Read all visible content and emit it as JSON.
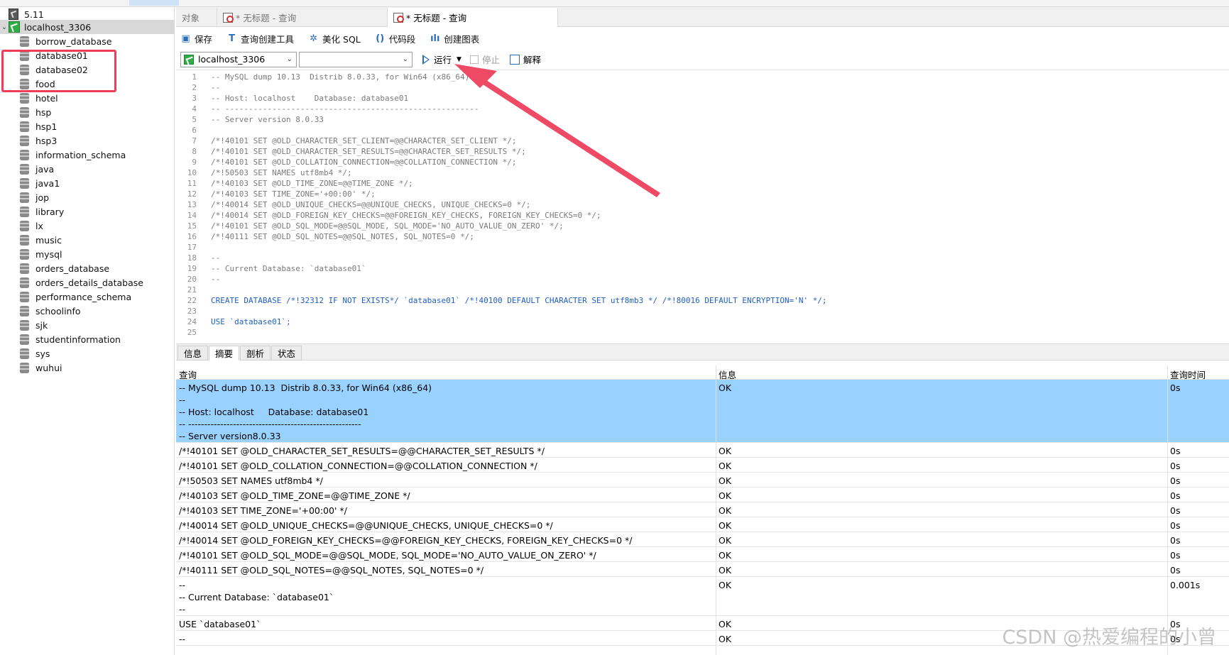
{
  "sidebar": {
    "server_label": "5.11",
    "connection_label": "localhost_3306",
    "databases": [
      "borrow_database",
      "database01",
      "database02",
      "food",
      "hotel",
      "hsp",
      "hsp1",
      "hsp3",
      "information_schema",
      "java",
      "java1",
      "jop",
      "library",
      "lx",
      "music",
      "mysql",
      "orders_database",
      "orders_details_database",
      "performance_schema",
      "schoolinfo",
      "sjk",
      "studentinformation",
      "sys",
      "wuhui"
    ]
  },
  "tabs": {
    "objects": "对象",
    "query1": "* 无标题 - 查询",
    "query2": "* 无标题 - 查询"
  },
  "toolbar": {
    "save": "保存",
    "query_builder": "查询创建工具",
    "beautify": "美化 SQL",
    "snippet": "代码段",
    "create_chart": "创建图表"
  },
  "toolbar2": {
    "connection": "localhost_3306",
    "database": "",
    "run": "运行",
    "stop": "停止",
    "explain": "解释"
  },
  "editor": {
    "lines": [
      {
        "n": "1",
        "text": "-- MySQL dump 10.13  Distrib 8.0.33, for Win64 (x86_64)",
        "kind": "comment"
      },
      {
        "n": "2",
        "text": "--",
        "kind": "comment"
      },
      {
        "n": "3",
        "text": "-- Host: localhost    Database: database01",
        "kind": "comment"
      },
      {
        "n": "4",
        "text": "-- ------------------------------------------------------",
        "kind": "comment"
      },
      {
        "n": "5",
        "text": "-- Server version 8.0.33",
        "kind": "comment"
      },
      {
        "n": "6",
        "text": "",
        "kind": "comment"
      },
      {
        "n": "7",
        "text": "/*!40101 SET @OLD_CHARACTER_SET_CLIENT=@@CHARACTER_SET_CLIENT */;",
        "kind": "comment"
      },
      {
        "n": "8",
        "text": "/*!40101 SET @OLD_CHARACTER_SET_RESULTS=@@CHARACTER_SET_RESULTS */;",
        "kind": "comment"
      },
      {
        "n": "9",
        "text": "/*!40101 SET @OLD_COLLATION_CONNECTION=@@COLLATION_CONNECTION */;",
        "kind": "comment"
      },
      {
        "n": "10",
        "text": "/*!50503 SET NAMES utf8mb4 */;",
        "kind": "comment"
      },
      {
        "n": "11",
        "text": "/*!40103 SET @OLD_TIME_ZONE=@@TIME_ZONE */;",
        "kind": "comment"
      },
      {
        "n": "12",
        "text": "/*!40103 SET TIME_ZONE='+00:00' */;",
        "kind": "comment"
      },
      {
        "n": "13",
        "text": "/*!40014 SET @OLD_UNIQUE_CHECKS=@@UNIQUE_CHECKS, UNIQUE_CHECKS=0 */;",
        "kind": "comment"
      },
      {
        "n": "14",
        "text": "/*!40014 SET @OLD_FOREIGN_KEY_CHECKS=@@FOREIGN_KEY_CHECKS, FOREIGN_KEY_CHECKS=0 */;",
        "kind": "comment"
      },
      {
        "n": "15",
        "text": "/*!40101 SET @OLD_SQL_MODE=@@SQL_MODE, SQL_MODE='NO_AUTO_VALUE_ON_ZERO' */;",
        "kind": "comment"
      },
      {
        "n": "16",
        "text": "/*!40111 SET @OLD_SQL_NOTES=@@SQL_NOTES, SQL_NOTES=0 */;",
        "kind": "comment"
      },
      {
        "n": "17",
        "text": "",
        "kind": "comment"
      },
      {
        "n": "18",
        "text": "--",
        "kind": "comment"
      },
      {
        "n": "19",
        "text": "-- Current Database: `database01`",
        "kind": "comment"
      },
      {
        "n": "20",
        "text": "--",
        "kind": "comment"
      },
      {
        "n": "21",
        "text": "",
        "kind": "comment"
      },
      {
        "n": "22",
        "text": "CREATE DATABASE /*!32312 IF NOT EXISTS*/ `database01` /*!40100 DEFAULT CHARACTER SET utf8mb3 */ /*!80016 DEFAULT ENCRYPTION='N' */;",
        "kind": "create"
      },
      {
        "n": "23",
        "text": "",
        "kind": "comment"
      },
      {
        "n": "24",
        "text": "USE `database01`;",
        "kind": "use"
      },
      {
        "n": "25",
        "text": "",
        "kind": "comment"
      }
    ]
  },
  "bottom_tabs": [
    "信息",
    "摘要",
    "剖析",
    "状态"
  ],
  "grid": {
    "headers": [
      "查询",
      "信息",
      "查询时间"
    ],
    "rows": [
      {
        "query": "-- MySQL dump 10.13  Distrib 8.0.33, for Win64 (x86_64)\n--\n-- Host: localhost     Database: database01\n-- ------------------------------------------------------\n-- Server version8.0.33",
        "info": "OK",
        "time": "0s",
        "highlight": true
      },
      {
        "query": "/*!40101 SET @OLD_CHARACTER_SET_RESULTS=@@CHARACTER_SET_RESULTS */",
        "info": "OK",
        "time": "0s"
      },
      {
        "query": "/*!40101 SET @OLD_COLLATION_CONNECTION=@@COLLATION_CONNECTION */",
        "info": "OK",
        "time": "0s"
      },
      {
        "query": "/*!50503 SET NAMES utf8mb4 */",
        "info": "OK",
        "time": "0s"
      },
      {
        "query": "/*!40103 SET @OLD_TIME_ZONE=@@TIME_ZONE */",
        "info": "OK",
        "time": "0s"
      },
      {
        "query": "/*!40103 SET TIME_ZONE='+00:00' */",
        "info": "OK",
        "time": "0s"
      },
      {
        "query": "/*!40014 SET @OLD_UNIQUE_CHECKS=@@UNIQUE_CHECKS, UNIQUE_CHECKS=0 */",
        "info": "OK",
        "time": "0s"
      },
      {
        "query": "/*!40014 SET @OLD_FOREIGN_KEY_CHECKS=@@FOREIGN_KEY_CHECKS, FOREIGN_KEY_CHECKS=0 */",
        "info": "OK",
        "time": "0s"
      },
      {
        "query": "/*!40101 SET @OLD_SQL_MODE=@@SQL_MODE, SQL_MODE='NO_AUTO_VALUE_ON_ZERO' */",
        "info": "OK",
        "time": "0s"
      },
      {
        "query": "/*!40111 SET @OLD_SQL_NOTES=@@SQL_NOTES, SQL_NOTES=0 */",
        "info": "OK",
        "time": "0s"
      },
      {
        "query": "--\n-- Current Database: `database01`\n--",
        "info": "OK",
        "time": "0.001s"
      },
      {
        "query": "USE `database01`",
        "info": "OK",
        "time": "0s"
      },
      {
        "query": "--",
        "info": "OK",
        "time": "0s"
      }
    ]
  },
  "watermark": "CSDN @热爱编程的小曾",
  "colors": {
    "annotation": "#ee3d5a",
    "selection": "#99d1ff"
  }
}
